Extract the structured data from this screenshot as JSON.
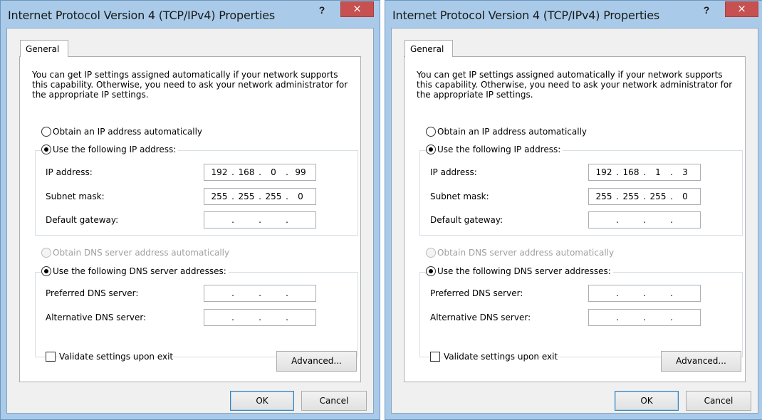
{
  "dialogs": [
    {
      "title": "Internet Protocol Version 4 (TCP/IPv4) Properties",
      "help_label": "?",
      "close_label": "×",
      "tab_label": "General",
      "intro_text": "You can get IP settings assigned automatically if your network supports this capability. Otherwise, you need to ask your network administrator for the appropriate IP settings.",
      "radio_auto_ip": "Obtain an IP address automatically",
      "radio_manual_ip": "Use the following IP address:",
      "ip_label": "IP address:",
      "ip_value": [
        "192",
        "168",
        "0",
        "99"
      ],
      "subnet_label": "Subnet mask:",
      "subnet_value": [
        "255",
        "255",
        "255",
        "0"
      ],
      "gateway_label": "Default gateway:",
      "gateway_value": [
        "",
        "",
        "",
        ""
      ],
      "radio_auto_dns": "Obtain DNS server address automatically",
      "radio_manual_dns": "Use the following DNS server addresses:",
      "preferred_dns_label": "Preferred DNS server:",
      "preferred_dns_value": [
        "",
        "",
        "",
        ""
      ],
      "alternate_dns_label": "Alternative DNS server:",
      "alternate_dns_value": [
        "",
        "",
        "",
        ""
      ],
      "validate_label": "Validate settings upon exit",
      "advanced_label": "Advanced...",
      "ok_label": "OK",
      "cancel_label": "Cancel"
    },
    {
      "title": "Internet Protocol Version 4 (TCP/IPv4) Properties",
      "help_label": "?",
      "close_label": "×",
      "tab_label": "General",
      "intro_text": "You can get IP settings assigned automatically if your network supports this capability. Otherwise, you need to ask your network administrator for the appropriate IP settings.",
      "radio_auto_ip": "Obtain an IP address automatically",
      "radio_manual_ip": "Use the following IP address:",
      "ip_label": "IP address:",
      "ip_value": [
        "192",
        "168",
        "1",
        "3"
      ],
      "subnet_label": "Subnet mask:",
      "subnet_value": [
        "255",
        "255",
        "255",
        "0"
      ],
      "gateway_label": "Default gateway:",
      "gateway_value": [
        "",
        "",
        "",
        ""
      ],
      "radio_auto_dns": "Obtain DNS server address automatically",
      "radio_manual_dns": "Use the following DNS server addresses:",
      "preferred_dns_label": "Preferred DNS server:",
      "preferred_dns_value": [
        "",
        "",
        "",
        ""
      ],
      "alternate_dns_label": "Alternative DNS server:",
      "alternate_dns_value": [
        "",
        "",
        "",
        ""
      ],
      "validate_label": "Validate settings upon exit",
      "advanced_label": "Advanced...",
      "ok_label": "OK",
      "cancel_label": "Cancel"
    }
  ],
  "colors": {
    "titlebar": "#a9cbe9",
    "close_button": "#c75050",
    "panel_background": "#ffffff",
    "window_background": "#f0f0f0"
  }
}
